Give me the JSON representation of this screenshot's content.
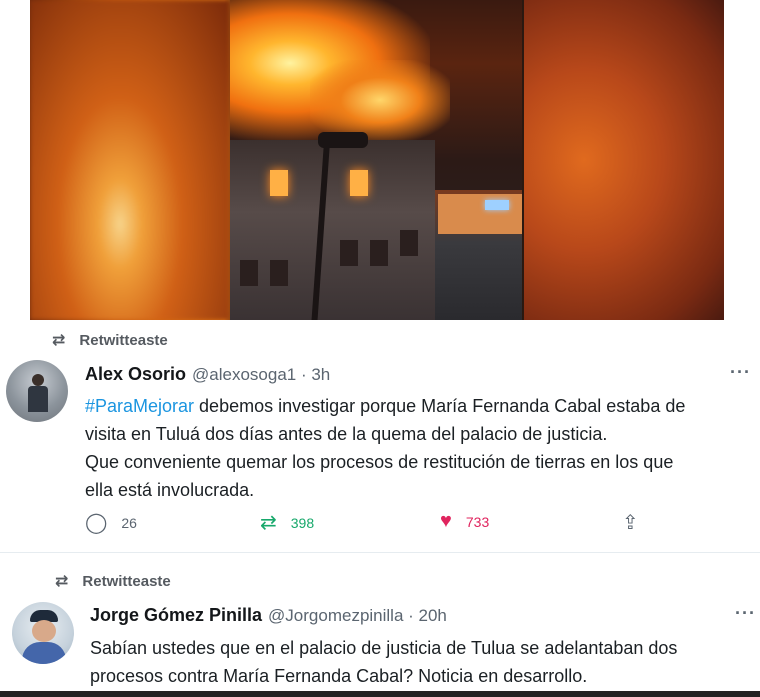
{
  "retweet1": {
    "label": "Retwitteaste"
  },
  "tweet1": {
    "name": "Alex Osorio",
    "handle": "@alexosoga1 · 3h",
    "hashtag": "#ParaMejorar",
    "text_after_hashtag": " debemos investigar porque María Fernanda Cabal estaba de\nvisita en Tuluá dos días antes de la quema del palacio de justicia.\nQue conveniente quemar los procesos de restitución de tierras en los que\nella está involucrada.",
    "more": "···",
    "replies": "26",
    "retweets": "398",
    "likes": "733",
    "icons": {
      "reply": "comment-icon",
      "retweet": "retweet-icon",
      "like": "heart-icon",
      "share": "share-icon"
    },
    "colors": {
      "retweet": "#17a86b",
      "like": "#e0245e",
      "hashtag": "#1b95e0"
    }
  },
  "retweet2": {
    "label": "Retwitteaste"
  },
  "tweet2": {
    "name": "Jorge Gómez Pinilla",
    "handle": "@Jorgomezpinilla · 20h",
    "text": "Sabían ustedes que en el palacio de justicia de Tulua se adelantaban dos\nprocesos contra María Fernanda Cabal? Noticia en desarrollo.",
    "more": "···"
  }
}
